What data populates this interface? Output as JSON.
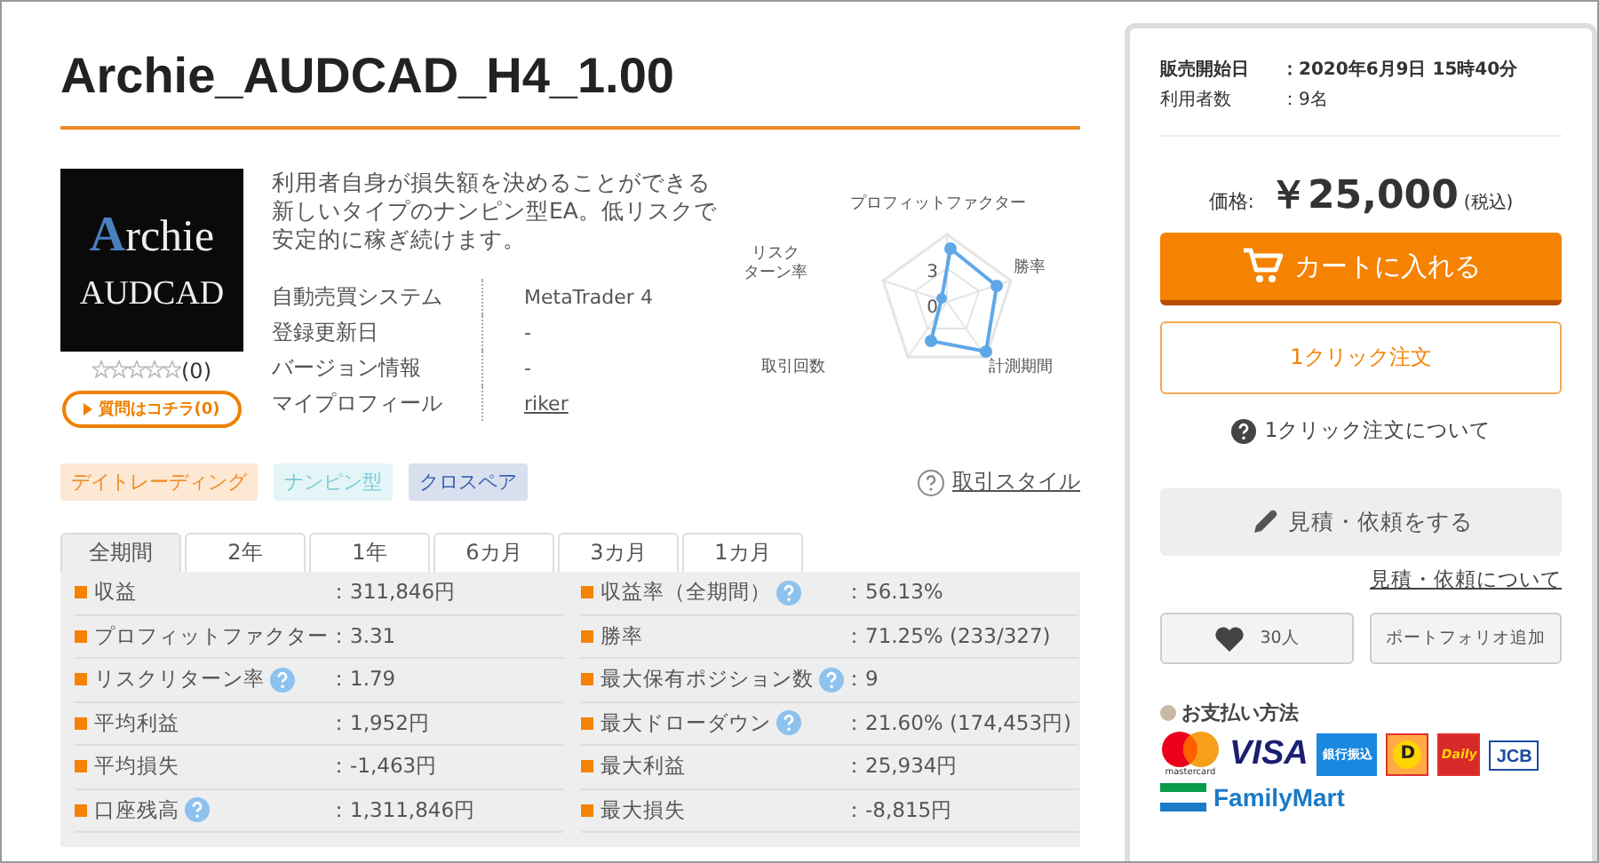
{
  "title": "Archie_AUDCAD_H4_1.00",
  "product": {
    "image_lines": [
      "Archie",
      "AUDCAD"
    ],
    "stars": 0,
    "rating_count": "(0)",
    "question_button": "質問はコチラ(0)",
    "description": "利用者自身が損失額を決めることができる新しいタイプのナンピン型EA。低リスクで安定的に稼ぎ続けます。",
    "specs": [
      {
        "label": "自動売買システム",
        "value": "MetaTrader 4",
        "kind": "text"
      },
      {
        "label": "登録更新日",
        "value": "-",
        "kind": "text"
      },
      {
        "label": "バージョン情報",
        "value": "-",
        "kind": "text"
      },
      {
        "label": "マイプロフィール",
        "value": "riker",
        "kind": "link"
      }
    ],
    "tags": [
      {
        "label": "デイトレーディング",
        "color": "#f08a24"
      },
      {
        "label": "ナンピン型",
        "color": "#7ccbd6"
      },
      {
        "label": "クロスペア",
        "color": "#3a62b0"
      }
    ],
    "style_link": "取引スタイル",
    "radar": {
      "labels": [
        [
          "プロフィットファクター"
        ],
        [
          "勝率"
        ],
        [
          "計測期間"
        ],
        [
          "取引回数"
        ],
        [
          "リスク",
          "ターン率"
        ]
      ],
      "ticks": [
        "3",
        "0"
      ]
    }
  },
  "period_tabs": [
    {
      "label": "全期間",
      "selected": true
    },
    {
      "label": "2年",
      "selected": false
    },
    {
      "label": "1年",
      "selected": false
    },
    {
      "label": "6カ月",
      "selected": false
    },
    {
      "label": "3カ月",
      "selected": false
    },
    {
      "label": "1カ月",
      "selected": false
    }
  ],
  "stats_left": [
    {
      "label": "収益",
      "value": "：311,846円",
      "help": false
    },
    {
      "label": "プロフィットファクター",
      "value": "：3.31",
      "help": false
    },
    {
      "label": "リスクリターン率",
      "value": "：1.79",
      "help": true
    },
    {
      "label": "平均利益",
      "value": "：1,952円",
      "help": false
    },
    {
      "label": "平均損失",
      "value": "：-1,463円",
      "help": false
    },
    {
      "label": "口座残高",
      "value": "：1,311,846円",
      "help": true
    }
  ],
  "stats_right": [
    {
      "label": "収益率（全期間）",
      "value": "：56.13%",
      "help": true
    },
    {
      "label": "勝率",
      "value": "：71.25% (233/327)",
      "help": false
    },
    {
      "label": "最大保有ポジション数",
      "value": "：9",
      "help": true
    },
    {
      "label": "最大ドローダウン",
      "value": "：21.60% (174,453円)",
      "help": true
    },
    {
      "label": "最大利益",
      "value": "：25,934円",
      "help": false
    },
    {
      "label": "最大損失",
      "value": "：-8,815円",
      "help": false
    }
  ],
  "side": {
    "info": [
      {
        "label": "販売開始日",
        "value": "：2020年6月9日 15時40分",
        "bold": true
      },
      {
        "label": "利用者数",
        "value": "：9名",
        "bold": false
      }
    ],
    "price_label": "価格:",
    "price": "￥25,000",
    "tax": "(税込)",
    "cart_button": "カートに入れる",
    "one_click_button": "1クリック注文",
    "one_click_help": "1クリック注文について",
    "quote_button": "見積・依頼をする",
    "quote_link": "見積・依頼について",
    "favorite_count": "30人",
    "portfolio_button": "ポートフォリオ追加",
    "payment_title": "お支払い方法",
    "payments": [
      {
        "kind": "mastercard",
        "label": "mastercard"
      },
      {
        "kind": "visa",
        "label": "VISA"
      },
      {
        "kind": "bank",
        "label": "銀行振込"
      },
      {
        "kind": "daily-d",
        "label": "D"
      },
      {
        "kind": "daily",
        "label": "Daily"
      },
      {
        "kind": "jcb",
        "label": "JCB"
      },
      {
        "kind": "familymart",
        "label": "FamilyMart"
      }
    ]
  }
}
